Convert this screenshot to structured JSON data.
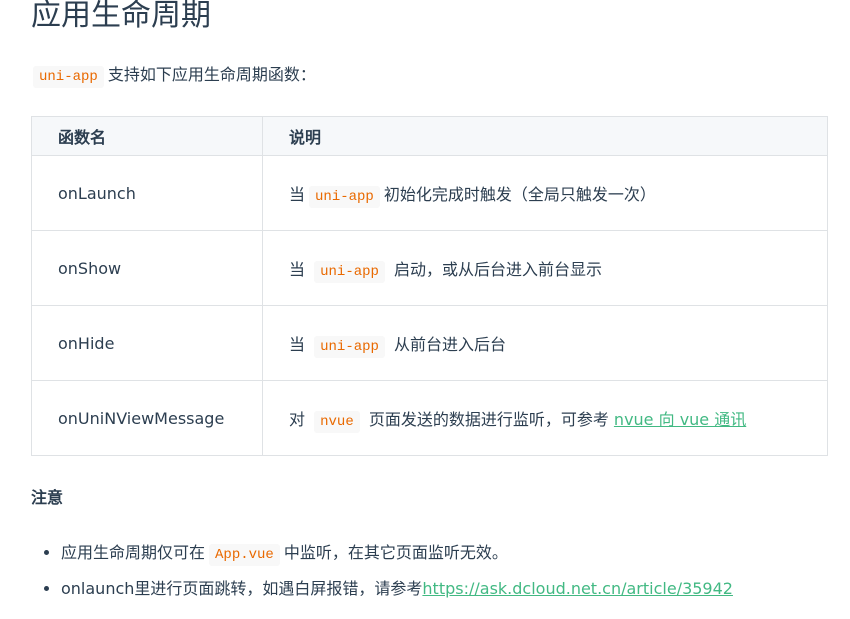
{
  "title": "应用生命周期",
  "intro": {
    "code": "uni-app",
    "text": "支持如下应用生命周期函数："
  },
  "table": {
    "headers": [
      "函数名",
      "说明"
    ],
    "rows": [
      {
        "name": "onLaunch",
        "pre": "当",
        "code": "uni-app",
        "post": "初始化完成时触发（全局只触发一次）"
      },
      {
        "name": "onShow",
        "pre": "当",
        "code": "uni-app",
        "post": "启动，或从后台进入前台显示"
      },
      {
        "name": "onHide",
        "pre": "当",
        "code": "uni-app",
        "post": "从前台进入后台"
      },
      {
        "name": "onUniNViewMessage",
        "pre": "对",
        "code": "nvue",
        "post": "页面发送的数据进行监听，可参考",
        "link": "nvue 向 vue 通讯"
      }
    ]
  },
  "note": {
    "heading": "注意",
    "items": [
      {
        "pre": "应用生命周期仅可在",
        "code": "App.vue",
        "post": "中监听，在其它页面监听无效。"
      },
      {
        "pre": "onlaunch里进行页面跳转，如遇白屏报错，请参考",
        "link": "https://ask.dcloud.net.cn/article/35942"
      }
    ]
  },
  "colors": {
    "text": "#2c3e50",
    "code": "#e96900",
    "link": "#42b983"
  }
}
